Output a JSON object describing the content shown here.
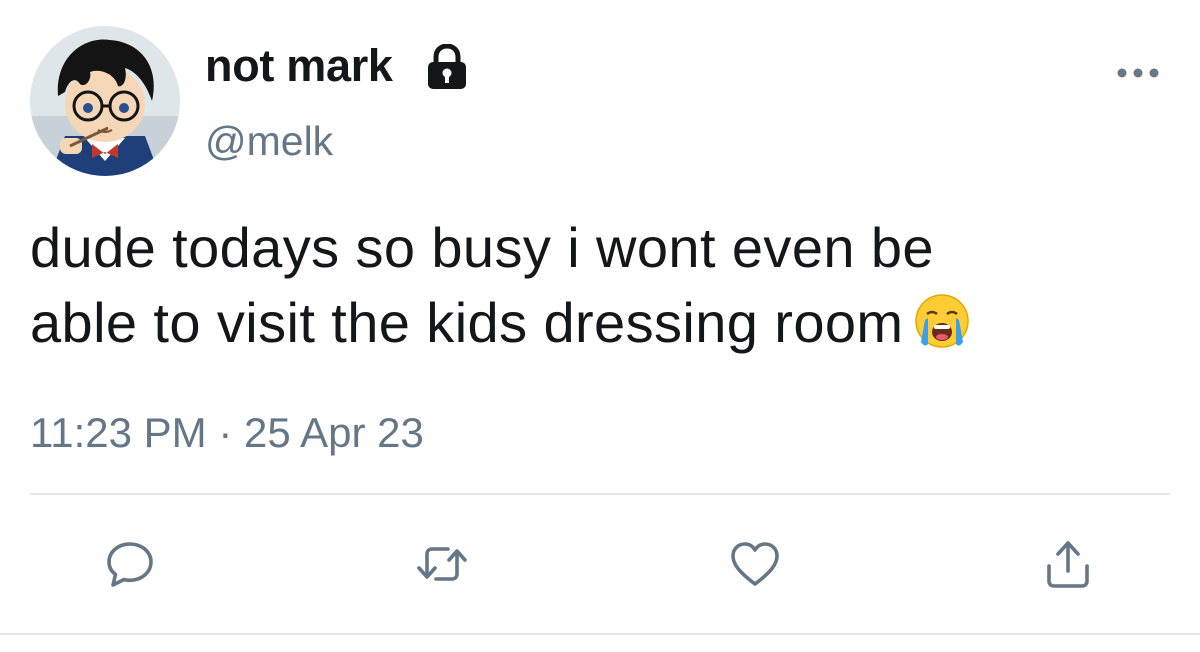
{
  "author": {
    "display_name": "not mark",
    "handle": "@melk",
    "avatar_icon": "anime-avatar",
    "protected_icon": "lock-icon"
  },
  "tweet": {
    "text_lines": [
      "dude todays so busy i wont even be",
      "able to visit the kids dressing room"
    ],
    "emoji": "loudly-crying-face-emoji",
    "time": "11:23 PM",
    "separator": "·",
    "date": "25 Apr 23"
  },
  "actions": [
    {
      "name": "reply",
      "icon": "comment-icon"
    },
    {
      "name": "retweet",
      "icon": "retweet-icon"
    },
    {
      "name": "like",
      "icon": "heart-icon"
    },
    {
      "name": "share",
      "icon": "share-icon"
    }
  ],
  "colors": {
    "text": "#14171a",
    "secondary": "#657786",
    "accent": "#1da1f2",
    "divider": "#e1e8ed"
  }
}
